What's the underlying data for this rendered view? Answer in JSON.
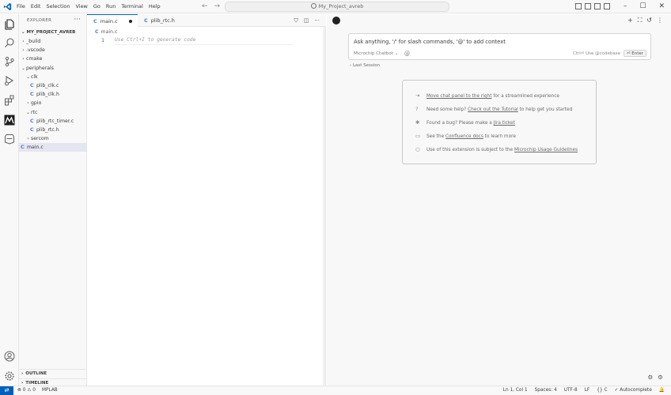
{
  "titlebar": {
    "menu": [
      "File",
      "Edit",
      "Selection",
      "View",
      "Go",
      "Run",
      "Terminal",
      "Help"
    ],
    "search_text": "My_Project_avreb",
    "icons": [
      "vscode-logo-icon",
      "back-arrow-icon",
      "forward-arrow-icon",
      "layout-icon",
      "minimize-icon",
      "maximize-icon",
      "close-icon"
    ]
  },
  "activity_bar": {
    "icons": [
      "explorer-icon",
      "search-icon",
      "source-control-icon",
      "run-debug-icon",
      "extensions-icon",
      "mplab-icon",
      "mplab-chip-icon",
      "account-icon",
      "manage-gear-icon"
    ]
  },
  "explorer": {
    "title": "EXPLORER",
    "more": "···",
    "root": "MY_PROJECT_AVREB",
    "tree": [
      {
        "label": "_build",
        "type": "folder",
        "depth": 1,
        "expanded": false
      },
      {
        "label": ".vscode",
        "type": "folder",
        "depth": 1,
        "expanded": false
      },
      {
        "label": "cmake",
        "type": "folder",
        "depth": 1,
        "expanded": false
      },
      {
        "label": "peripherals",
        "type": "folder",
        "depth": 1,
        "expanded": true
      },
      {
        "label": "clk",
        "type": "folder",
        "depth": 2,
        "expanded": true
      },
      {
        "label": "plib_clk.c",
        "type": "c",
        "depth": 3
      },
      {
        "label": "plib_clk.h",
        "type": "h",
        "depth": 3
      },
      {
        "label": "gpio",
        "type": "folder",
        "depth": 2,
        "expanded": false
      },
      {
        "label": "rtc",
        "type": "folder",
        "depth": 2,
        "expanded": true
      },
      {
        "label": "plib_rtc_timer.c",
        "type": "c",
        "depth": 3
      },
      {
        "label": "plib_rtc.h",
        "type": "h",
        "depth": 3
      },
      {
        "label": "sercom",
        "type": "folder",
        "depth": 2,
        "expanded": false
      },
      {
        "label": "main.c",
        "type": "c",
        "depth": 1,
        "selected": true
      }
    ],
    "outline": "OUTLINE",
    "timeline": "TIMELINE"
  },
  "editor": {
    "tabs": [
      {
        "label": "main.c",
        "active": true,
        "dirty": true
      },
      {
        "label": "plib_rtc.h",
        "active": false
      }
    ],
    "breadcrumb": "main.c",
    "line_number": "1",
    "ghost_text": "Use Ctrl+I to generate code"
  },
  "chat": {
    "prompt_placeholder": "Ask anything, '/' for slash commands, '@' to add context",
    "model": "Microchip Chatbot ⌄",
    "at_symbol": "@",
    "hint": "Ctrl⏎ Use @codebase",
    "enter": "⏎ Enter",
    "last_session": "Last Session",
    "info_rows": [
      {
        "icon": "move-panel-icon",
        "link": "Move chat panel to the right",
        "text_after": " for a streamlined experience"
      },
      {
        "icon": "help-icon",
        "text_before": "Need some help? ",
        "link": "Check out the Tutorial",
        "text_after": " to help get you started"
      },
      {
        "icon": "bug-icon",
        "text_before": "Found a bug? Please make a ",
        "link": "Jira ticket",
        "text_after": ""
      },
      {
        "icon": "book-icon",
        "text_before": "See the ",
        "link": "Confluence docs",
        "text_after": " to learn more"
      },
      {
        "icon": "info-icon",
        "text_before": "Use of this extension is subject to the ",
        "link": "Microchip Usage Guidelines",
        "text_after": ""
      }
    ]
  },
  "statusbar": {
    "remote": "⇄",
    "problems": "⊗ 0 ⚠ 0",
    "mplab": "MPLAB",
    "position": "Ln 1, Col 1",
    "spaces": "Spaces: 4",
    "encoding": "UTF-8",
    "eol": "LF",
    "language": "{} C",
    "autocomplete": "✓ Autocomplete",
    "bell": "🔔"
  }
}
